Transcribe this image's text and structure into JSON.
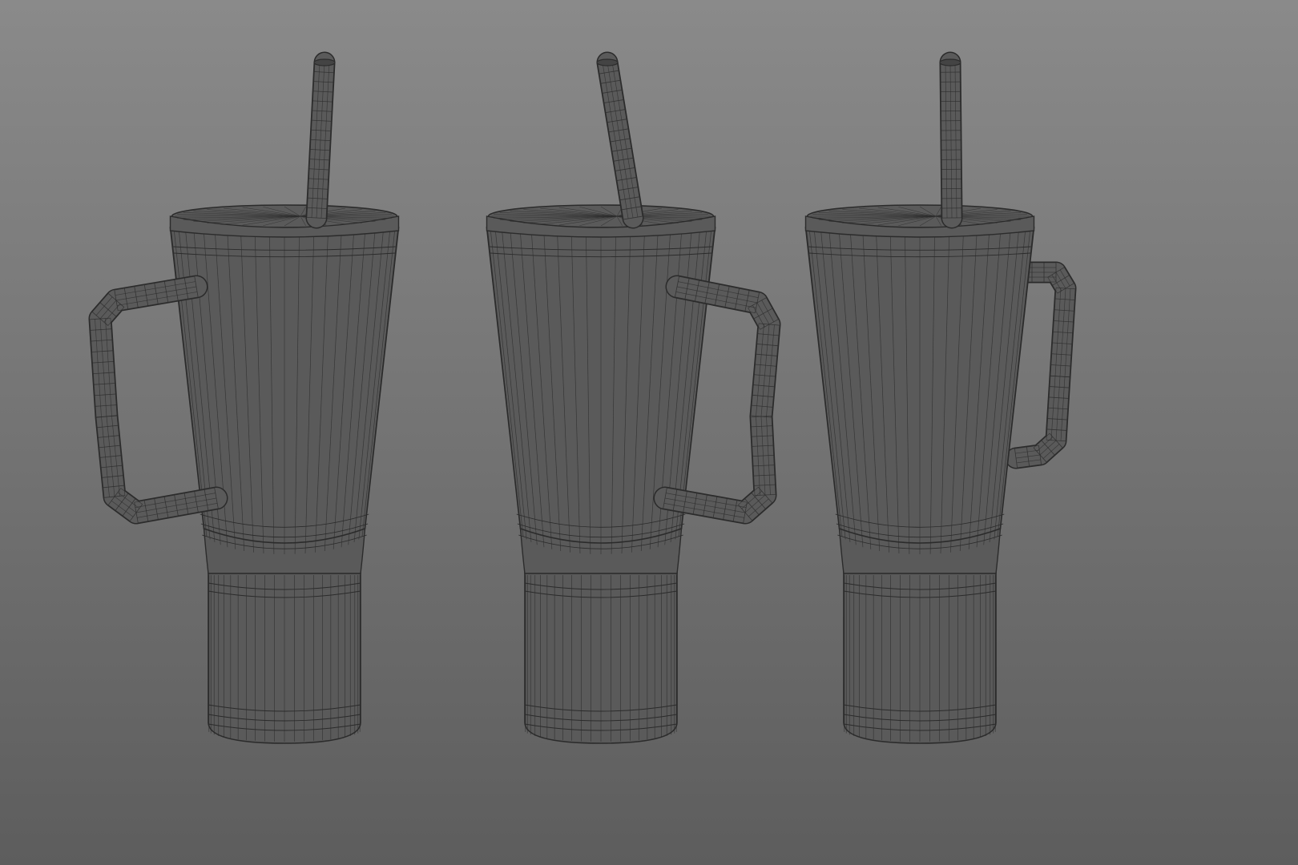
{
  "scene": {
    "view": "wireframe-on-shaded",
    "background_top": "#8a8a8a",
    "background_bottom": "#5d5d5d",
    "surface_color": "#5a5a5a",
    "wire_color": "#2b2b2b",
    "objects": [
      {
        "name": "tumbler-left",
        "handle_side": "left"
      },
      {
        "name": "tumbler-center",
        "handle_side": "right"
      },
      {
        "name": "tumbler-right",
        "handle_side": "right-back"
      }
    ]
  }
}
